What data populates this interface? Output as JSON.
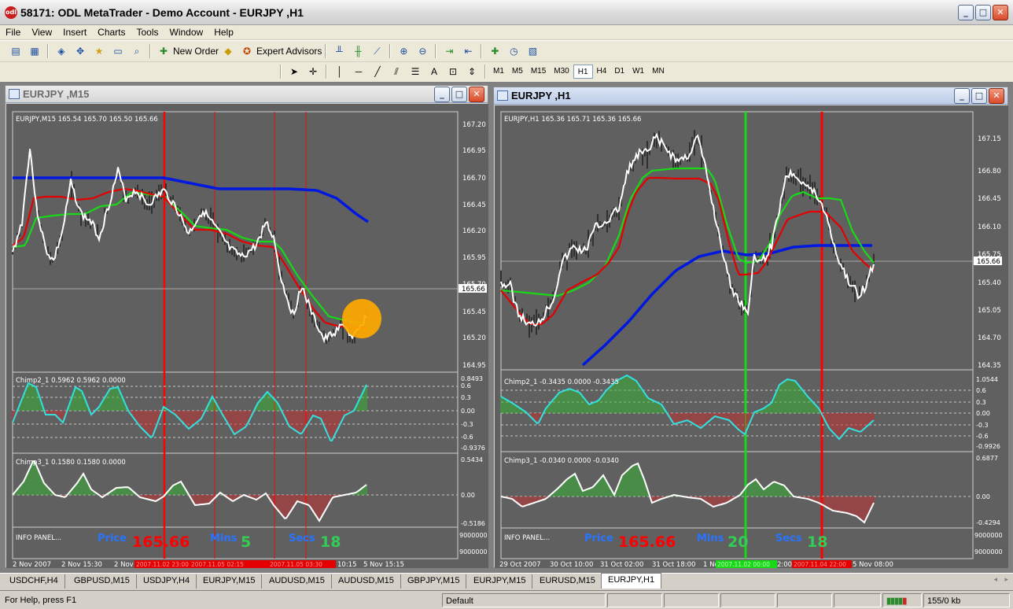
{
  "app": {
    "title": "58171: ODL MetaTrader - Demo Account - EURJPY ,H1",
    "icon_label": "odl"
  },
  "menu": [
    "File",
    "View",
    "Insert",
    "Charts",
    "Tools",
    "Window",
    "Help"
  ],
  "toolbar": {
    "new_order": "New Order",
    "expert_advisors": "Expert Advisors",
    "text_tool": "A",
    "timeframes": [
      "M1",
      "M5",
      "M15",
      "M30",
      "H1",
      "H4",
      "D1",
      "W1",
      "MN"
    ],
    "active_timeframe": "H1"
  },
  "left_chart": {
    "window_title": "EURJPY ,M15",
    "header": "EURJPY,M15  165.54 165.70 165.50 165.66",
    "price_scale": [
      "167.20",
      "166.95",
      "166.70",
      "166.45",
      "166.20",
      "165.95",
      "165.70",
      "165.45",
      "165.20",
      "164.95"
    ],
    "current_price": "165.66",
    "ind1_label": "Chimp2_1 0.5962 0.5962 0.0000",
    "ind1_scale": [
      "0.8493",
      "0.6",
      "0.3",
      "0.00",
      "-0.3",
      "-0.6",
      "-0.9376"
    ],
    "ind2_label": "Chimp3_1 0.1580 0.1580 0.0000",
    "ind2_scale": [
      "0.5434",
      "0.00",
      "-0.5186"
    ],
    "info_label": "INFO PANEL...",
    "info_scale": [
      "9000000",
      "9000000"
    ],
    "price_word": "Price",
    "price_value": "165.66",
    "mins_word": "Mins",
    "mins_value": "5",
    "secs_word": "Secs",
    "secs_value": "18",
    "time_axis": [
      "2 Nov 2007",
      "2 Nov 15:30",
      "2 Nov",
      "10:15",
      "5 Nov 15:15"
    ],
    "time_markers": [
      "2007.11.02 23:00",
      "2007.11.05 02:15",
      "2007.11.05 03:30"
    ]
  },
  "right_chart": {
    "window_title": "EURJPY ,H1",
    "header": "EURJPY,H1  165.36 165.71 165.36 165.66",
    "price_scale": [
      "167.15",
      "166.80",
      "166.45",
      "166.10",
      "165.75",
      "165.40",
      "165.05",
      "164.70",
      "164.35"
    ],
    "current_price": "165.66",
    "ind1_label": "Chimp2_1 -0.3435 0.0000 -0.3435",
    "ind1_scale": [
      "1.0544",
      "0.6",
      "0.3",
      "0.00",
      "-0.3",
      "-0.6",
      "-0.9926"
    ],
    "ind2_label": "Chimp3_1 -0.0340 0.0000 -0.0340",
    "ind2_scale": [
      "0.6877",
      "0.00",
      "-0.4294"
    ],
    "info_label": "INFO PANEL...",
    "info_scale": [
      "9000000",
      "9000000"
    ],
    "price_word": "Price",
    "price_value": "165.66",
    "mins_word": "Mins",
    "mins_value": "20",
    "secs_word": "Secs",
    "secs_value": "18",
    "time_axis": [
      "29 Oct 2007",
      "30 Oct 10:00",
      "31 Oct 02:00",
      "31 Oct 18:00",
      "1 No",
      "2:00",
      "5 Nov 08:00"
    ],
    "time_markers": [
      "2007.11.02 00:00",
      "2007.11.04 22:00"
    ]
  },
  "tabs": [
    "USDCHF,H4",
    "GBPUSD,M15",
    "USDJPY,H4",
    "EURJPY,M15",
    "AUDUSD,M15",
    "AUDUSD,M15",
    "GBPJPY,M15",
    "EURJPY,M15",
    "EURUSD,M15",
    "EURJPY,H1"
  ],
  "active_tab": "EURJPY,H1",
  "status": {
    "help": "For Help, press F1",
    "profile": "Default",
    "traffic": "155/0 kb"
  },
  "colors": {
    "chart_bg": "#606060",
    "blue_ma": "#0018e0",
    "red_line": "#e40000",
    "green_line": "#18d818",
    "price_white": "#ffffff",
    "osc_cyan": "#33e0e0",
    "hist_green": "#2fb82f",
    "hist_red": "#c82a2a",
    "info_blue": "#2874ff",
    "info_red": "#ff0000",
    "info_green": "#33cc55",
    "highlight_orange": "#ffaa00"
  }
}
